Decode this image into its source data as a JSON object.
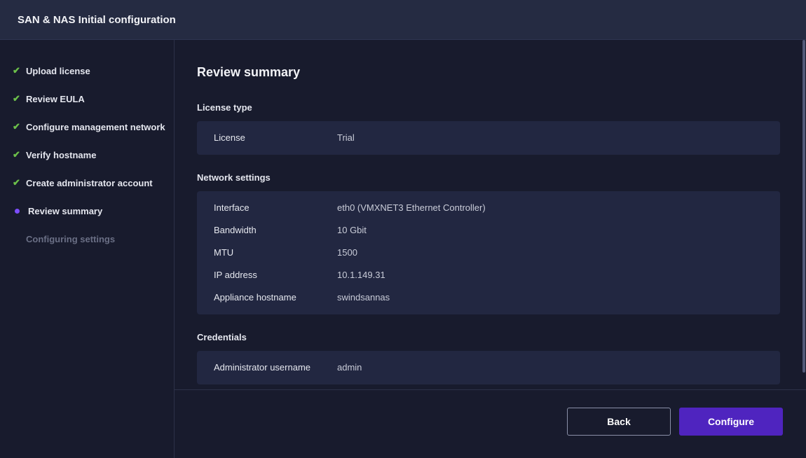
{
  "title": "SAN & NAS Initial configuration",
  "steps": [
    {
      "label": "Upload license",
      "status": "done"
    },
    {
      "label": "Review EULA",
      "status": "done"
    },
    {
      "label": "Configure management network",
      "status": "done"
    },
    {
      "label": "Verify hostname",
      "status": "done"
    },
    {
      "label": "Create administrator account",
      "status": "done"
    },
    {
      "label": "Review summary",
      "status": "current"
    },
    {
      "label": "Configuring settings",
      "status": "pending"
    }
  ],
  "main": {
    "heading": "Review summary",
    "license": {
      "title": "License type",
      "rows": [
        {
          "k": "License",
          "v": "Trial"
        }
      ]
    },
    "network": {
      "title": "Network settings",
      "rows": [
        {
          "k": "Interface",
          "v": "eth0 (VMXNET3 Ethernet Controller)"
        },
        {
          "k": "Bandwidth",
          "v": "10 Gbit"
        },
        {
          "k": "MTU",
          "v": "1500"
        },
        {
          "k": "IP address",
          "v": "10.1.149.31"
        },
        {
          "k": "Appliance hostname",
          "v": "swindsannas"
        }
      ]
    },
    "credentials": {
      "title": "Credentials",
      "rows": [
        {
          "k": "Administrator username",
          "v": "admin"
        }
      ]
    }
  },
  "footer": {
    "back": "Back",
    "configure": "Configure"
  },
  "colors": {
    "accent": "#4f24bf",
    "done": "#6cc04a",
    "current": "#7c4dff"
  }
}
